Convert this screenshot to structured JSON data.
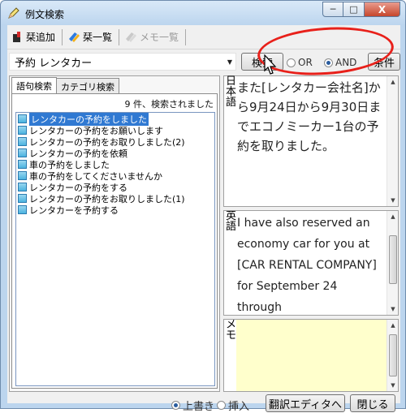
{
  "window": {
    "title": "例文検索",
    "minimize_label": "─",
    "maximize_label": "□",
    "close_label": "X"
  },
  "toolbar": {
    "add_label": "栞追加",
    "list_label": "栞一覧",
    "memo_list_label": "メモ一覧"
  },
  "search": {
    "query": "予約 レンタカー",
    "search_button": "検索",
    "or_label": "OR",
    "and_label": "AND",
    "or_selected": false,
    "and_selected": true,
    "conditions_button": "条件"
  },
  "tabs": [
    {
      "label": "語句検索",
      "active": true
    },
    {
      "label": "カテゴリ検索",
      "active": false
    }
  ],
  "results": {
    "count_text": "9 件、検索されました",
    "items": [
      "レンタカーの予約をしました",
      "レンタカーの予約をお願いします",
      "レンタカーの予約をお取りしました(2)",
      "レンタカーの予約を依頼",
      "車の予約をしました",
      "車の予約をしてくださいませんか",
      "レンタカーの予約をする",
      "レンタカーの予約をお取りしました(1)",
      "レンタカーを予約する"
    ],
    "selected_index": 0
  },
  "japanese": {
    "label": "日本語",
    "text": "また[レンタカー会社名]から9月24日から9月30日までエコノミーカー1台の予約を取りました。"
  },
  "english": {
    "label": "英語",
    "text": "I have also reserved an economy car for you at [CAR RENTAL COMPANY] for September 24 through"
  },
  "memo": {
    "label": "メモ",
    "text": ""
  },
  "bottom": {
    "overwrite_label": "上書き",
    "insert_label": "挿入",
    "overwrite_selected": true,
    "to_editor_button": "翻訳エディタへ",
    "close_button": "閉じる"
  },
  "colors": {
    "annotation": "#e8201a",
    "selection": "#3079d2",
    "memo_bg": "#ffffcc"
  }
}
